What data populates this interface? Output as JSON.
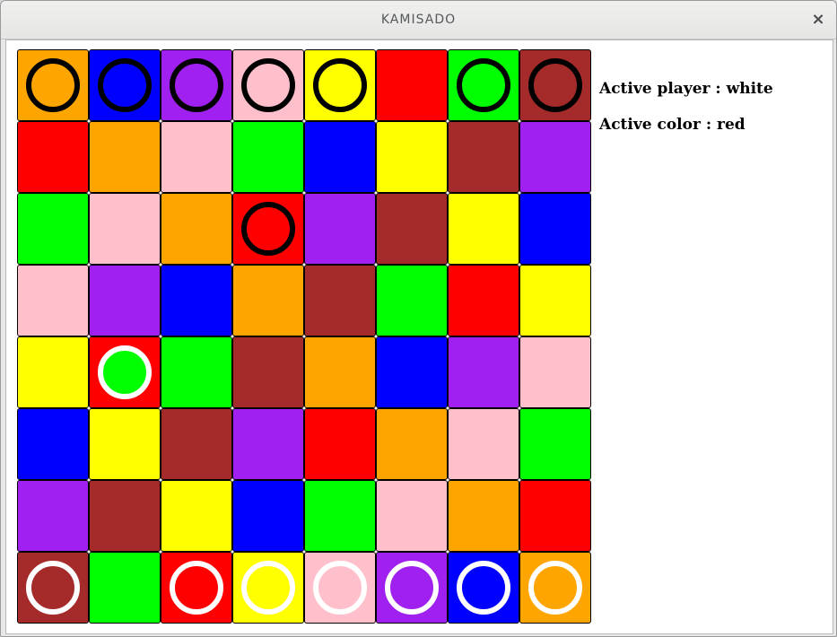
{
  "window": {
    "title": "KAMISADO",
    "close_icon": "close-icon"
  },
  "colors": {
    "orange": "#ffa500",
    "blue": "#0000ff",
    "purple": "#a020f0",
    "pink": "#ffc0cb",
    "yellow": "#ffff00",
    "red": "#ff0000",
    "green": "#00ff00",
    "brown": "#a52a2a",
    "black": "#000000",
    "white": "#ffffff"
  },
  "board": {
    "rows": [
      [
        "orange",
        "blue",
        "purple",
        "pink",
        "yellow",
        "red",
        "green",
        "brown"
      ],
      [
        "red",
        "orange",
        "pink",
        "green",
        "blue",
        "yellow",
        "brown",
        "purple"
      ],
      [
        "green",
        "pink",
        "orange",
        "red",
        "purple",
        "brown",
        "yellow",
        "blue"
      ],
      [
        "pink",
        "purple",
        "blue",
        "orange",
        "brown",
        "green",
        "red",
        "yellow"
      ],
      [
        "yellow",
        "red",
        "green",
        "brown",
        "orange",
        "blue",
        "purple",
        "pink"
      ],
      [
        "blue",
        "yellow",
        "brown",
        "purple",
        "red",
        "orange",
        "pink",
        "green"
      ],
      [
        "purple",
        "brown",
        "yellow",
        "blue",
        "green",
        "pink",
        "orange",
        "red"
      ],
      [
        "brown",
        "green",
        "red",
        "yellow",
        "pink",
        "purple",
        "blue",
        "orange"
      ]
    ],
    "pieces": [
      {
        "row": 0,
        "col": 0,
        "color": "orange",
        "player": "black"
      },
      {
        "row": 0,
        "col": 1,
        "color": "blue",
        "player": "black"
      },
      {
        "row": 0,
        "col": 2,
        "color": "purple",
        "player": "black"
      },
      {
        "row": 0,
        "col": 3,
        "color": "pink",
        "player": "black"
      },
      {
        "row": 0,
        "col": 4,
        "color": "yellow",
        "player": "black"
      },
      {
        "row": 2,
        "col": 3,
        "color": "red",
        "player": "black"
      },
      {
        "row": 0,
        "col": 6,
        "color": "green",
        "player": "black"
      },
      {
        "row": 0,
        "col": 7,
        "color": "brown",
        "player": "black"
      },
      {
        "row": 7,
        "col": 0,
        "color": "brown",
        "player": "white"
      },
      {
        "row": 4,
        "col": 1,
        "color": "green",
        "player": "white"
      },
      {
        "row": 7,
        "col": 2,
        "color": "red",
        "player": "white"
      },
      {
        "row": 7,
        "col": 3,
        "color": "yellow",
        "player": "white"
      },
      {
        "row": 7,
        "col": 4,
        "color": "pink",
        "player": "white"
      },
      {
        "row": 7,
        "col": 5,
        "color": "purple",
        "player": "white"
      },
      {
        "row": 7,
        "col": 6,
        "color": "blue",
        "player": "white"
      },
      {
        "row": 7,
        "col": 7,
        "color": "orange",
        "player": "white"
      }
    ]
  },
  "status": {
    "active_player": "Active player : white",
    "active_color": "Active color : red"
  }
}
